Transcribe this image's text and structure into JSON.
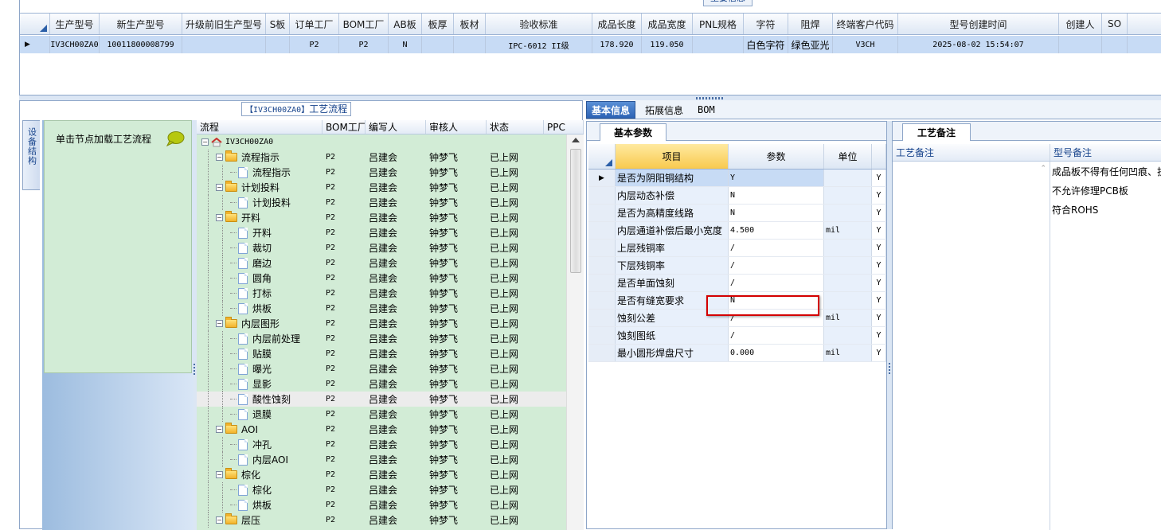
{
  "top_grid": {
    "caption": "主要信息",
    "columns": [
      {
        "label": "生产型号",
        "w": 62
      },
      {
        "label": "新生产型号",
        "w": 104
      },
      {
        "label": "升级前旧生产型号",
        "w": 105
      },
      {
        "label": "S板",
        "w": 30
      },
      {
        "label": "订单工厂",
        "w": 62
      },
      {
        "label": "BOM工厂",
        "w": 62
      },
      {
        "label": "AB板",
        "w": 42
      },
      {
        "label": "板厚",
        "w": 40
      },
      {
        "label": "板材",
        "w": 40
      },
      {
        "label": "验收标准",
        "w": 134
      },
      {
        "label": "成品长度",
        "w": 62
      },
      {
        "label": "成品宽度",
        "w": 64
      },
      {
        "label": "PNL规格",
        "w": 64
      },
      {
        "label": "字符",
        "w": 56
      },
      {
        "label": "阻焊",
        "w": 56
      },
      {
        "label": "终端客户代码",
        "w": 82
      },
      {
        "label": "型号创建时间",
        "w": 202
      },
      {
        "label": "创建人",
        "w": 54
      },
      {
        "label": "SO",
        "w": 32
      }
    ],
    "row": [
      "IV3CH00ZA0",
      "10011800008799",
      "",
      "",
      "P2",
      "P2",
      "N",
      "",
      "",
      "IPC-6012 II级",
      "178.920",
      "119.050",
      "",
      "白色字符",
      "绿色亚光",
      "V3CH",
      "2025-08-02 15:54:07",
      "",
      ""
    ]
  },
  "left_panel": {
    "caption_code": "【IV3CH00ZA0】",
    "caption_text": "工艺流程",
    "vertical_tab": "设备结构",
    "side_hint": "单击节点加载工艺流程",
    "tree_headers": [
      "流程",
      "BOM工厂",
      "编写人",
      "审核人",
      "状态",
      "PPC"
    ],
    "tree_rows": [
      {
        "level": 0,
        "type": "root",
        "name": "IV3CH00ZA0",
        "bom": "",
        "writer": "",
        "reviewer": "",
        "status": ""
      },
      {
        "level": 1,
        "type": "folder",
        "name": "流程指示",
        "bom": "P2",
        "writer": "吕建会",
        "reviewer": "钟梦飞",
        "status": "已上网"
      },
      {
        "level": 2,
        "type": "doc",
        "name": "流程指示",
        "bom": "P2",
        "writer": "吕建会",
        "reviewer": "钟梦飞",
        "status": "已上网"
      },
      {
        "level": 1,
        "type": "folder",
        "name": "计划投料",
        "bom": "P2",
        "writer": "吕建会",
        "reviewer": "钟梦飞",
        "status": "已上网"
      },
      {
        "level": 2,
        "type": "doc",
        "name": "计划投料",
        "bom": "P2",
        "writer": "吕建会",
        "reviewer": "钟梦飞",
        "status": "已上网"
      },
      {
        "level": 1,
        "type": "folder",
        "name": "开料",
        "bom": "P2",
        "writer": "吕建会",
        "reviewer": "钟梦飞",
        "status": "已上网"
      },
      {
        "level": 2,
        "type": "doc",
        "name": "开料",
        "bom": "P2",
        "writer": "吕建会",
        "reviewer": "钟梦飞",
        "status": "已上网"
      },
      {
        "level": 2,
        "type": "doc",
        "name": "裁切",
        "bom": "P2",
        "writer": "吕建会",
        "reviewer": "钟梦飞",
        "status": "已上网"
      },
      {
        "level": 2,
        "type": "doc",
        "name": "磨边",
        "bom": "P2",
        "writer": "吕建会",
        "reviewer": "钟梦飞",
        "status": "已上网"
      },
      {
        "level": 2,
        "type": "doc",
        "name": "圆角",
        "bom": "P2",
        "writer": "吕建会",
        "reviewer": "钟梦飞",
        "status": "已上网"
      },
      {
        "level": 2,
        "type": "doc",
        "name": "打标",
        "bom": "P2",
        "writer": "吕建会",
        "reviewer": "钟梦飞",
        "status": "已上网"
      },
      {
        "level": 2,
        "type": "doc",
        "name": "烘板",
        "bom": "P2",
        "writer": "吕建会",
        "reviewer": "钟梦飞",
        "status": "已上网"
      },
      {
        "level": 1,
        "type": "folder",
        "name": "内层图形",
        "bom": "P2",
        "writer": "吕建会",
        "reviewer": "钟梦飞",
        "status": "已上网"
      },
      {
        "level": 2,
        "type": "doc",
        "name": "内层前处理",
        "bom": "P2",
        "writer": "吕建会",
        "reviewer": "钟梦飞",
        "status": "已上网"
      },
      {
        "level": 2,
        "type": "doc",
        "name": "贴膜",
        "bom": "P2",
        "writer": "吕建会",
        "reviewer": "钟梦飞",
        "status": "已上网"
      },
      {
        "level": 2,
        "type": "doc",
        "name": "曝光",
        "bom": "P2",
        "writer": "吕建会",
        "reviewer": "钟梦飞",
        "status": "已上网"
      },
      {
        "level": 2,
        "type": "doc",
        "name": "显影",
        "bom": "P2",
        "writer": "吕建会",
        "reviewer": "钟梦飞",
        "status": "已上网"
      },
      {
        "level": 2,
        "type": "doc",
        "name": "酸性蚀刻",
        "bom": "P2",
        "writer": "吕建会",
        "reviewer": "钟梦飞",
        "status": "已上网",
        "selected": true
      },
      {
        "level": 2,
        "type": "doc",
        "name": "退膜",
        "bom": "P2",
        "writer": "吕建会",
        "reviewer": "钟梦飞",
        "status": "已上网"
      },
      {
        "level": 1,
        "type": "folder",
        "name": "AOI",
        "bom": "P2",
        "writer": "吕建会",
        "reviewer": "钟梦飞",
        "status": "已上网"
      },
      {
        "level": 2,
        "type": "doc",
        "name": "冲孔",
        "bom": "P2",
        "writer": "吕建会",
        "reviewer": "钟梦飞",
        "status": "已上网"
      },
      {
        "level": 2,
        "type": "doc",
        "name": "内层AOI",
        "bom": "P2",
        "writer": "吕建会",
        "reviewer": "钟梦飞",
        "status": "已上网"
      },
      {
        "level": 1,
        "type": "folder",
        "name": "棕化",
        "bom": "P2",
        "writer": "吕建会",
        "reviewer": "钟梦飞",
        "status": "已上网"
      },
      {
        "level": 2,
        "type": "doc",
        "name": "棕化",
        "bom": "P2",
        "writer": "吕建会",
        "reviewer": "钟梦飞",
        "status": "已上网"
      },
      {
        "level": 2,
        "type": "doc",
        "name": "烘板",
        "bom": "P2",
        "writer": "吕建会",
        "reviewer": "钟梦飞",
        "status": "已上网"
      },
      {
        "level": 1,
        "type": "folder",
        "name": "层压",
        "bom": "P2",
        "writer": "吕建会",
        "reviewer": "钟梦飞",
        "status": "已上网"
      }
    ]
  },
  "right_tabs": [
    "基本信息",
    "拓展信息",
    "BOM"
  ],
  "basic_params": {
    "tab_label": "基本参数",
    "headers": [
      "项目",
      "参数",
      "单位"
    ],
    "rows": [
      {
        "item": "是否为阴阳铜结构",
        "value": "Y",
        "unit": "",
        "flag": "Y",
        "selected": true
      },
      {
        "item": "内层动态补偿",
        "value": "N",
        "unit": "",
        "flag": "Y"
      },
      {
        "item": "是否为高精度线路",
        "value": "N",
        "unit": "",
        "flag": "Y"
      },
      {
        "item": "内层通道补偿后最小宽度",
        "value": "4.500",
        "unit": "mil",
        "flag": "Y"
      },
      {
        "item": "上层残铜率",
        "value": "/",
        "unit": "",
        "flag": "Y"
      },
      {
        "item": "下层残铜率",
        "value": "/",
        "unit": "",
        "flag": "Y"
      },
      {
        "item": "是否单面蚀刻",
        "value": "/",
        "unit": "",
        "flag": "Y"
      },
      {
        "item": "是否有缝宽要求",
        "value": "N",
        "unit": "",
        "flag": "Y"
      },
      {
        "item": "蚀刻公差",
        "value": "/",
        "unit": "mil",
        "flag": "Y"
      },
      {
        "item": "蚀刻图纸",
        "value": "/",
        "unit": "",
        "flag": "Y"
      },
      {
        "item": "最小圆形焊盘尺寸",
        "value": "0.000",
        "unit": "mil",
        "flag": "Y"
      }
    ]
  },
  "process_notes": {
    "tab_label": "工艺备注",
    "headers": [
      "工艺备注",
      "型号备注"
    ],
    "model_notes": [
      "成品板不得有任何凹痕、折",
      "不允许修理PCB板",
      "符合ROHS"
    ]
  },
  "colors": {
    "accent": "#2d63b5",
    "tree_bg": "#d2ecd6",
    "selection": "#c7dbf5",
    "highlight_box": "#d40000"
  }
}
